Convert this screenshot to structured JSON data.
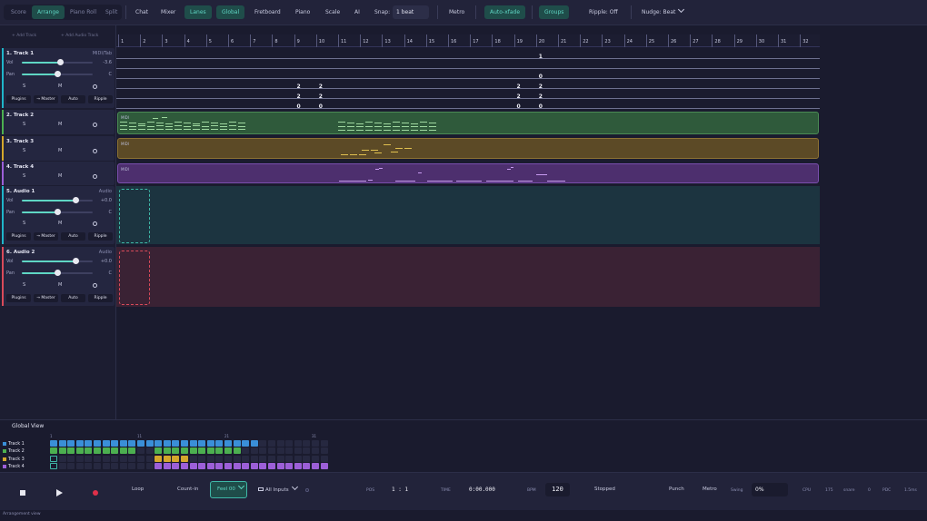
{
  "toolbar": {
    "view_tabs": [
      "Score",
      "Arrange",
      "Piano Roll",
      "Split"
    ],
    "active_view": "Arrange",
    "chat": "Chat",
    "mixer": "Mixer",
    "lanes": "Lanes",
    "global": "Global",
    "fretboard": "Fretboard",
    "piano": "Piano",
    "scale": "Scale",
    "ai": "AI",
    "snap_label": "Snap:",
    "snap_value": "1 beat",
    "metro": "Metro",
    "auto_xfade": "Auto-xfade",
    "groups": "Groups",
    "ripple": "Ripple: Off",
    "nudge": "Nudge: Beat"
  },
  "panel": {
    "add_track": "+ Add Track",
    "add_audio_track": "+ Add Audio Track",
    "labels": {
      "vol": "Vol",
      "pan": "Pan",
      "solo": "S",
      "mute": "M",
      "plugins": "Plugins",
      "master": "→ Master",
      "auto": "Auto",
      "ripple": "Ripple"
    },
    "tracks": [
      {
        "name": "1. Track 1",
        "kind": "MIDI/Tab",
        "vol": "-3.6",
        "pan": "C",
        "vol_level": 0.54,
        "pan_level": 0.5,
        "color": "#1fb5c9"
      },
      {
        "name": "2. Track 2",
        "color": "#4caf50"
      },
      {
        "name": "3. Track 3",
        "color": "#d4a72c"
      },
      {
        "name": "4. Track 4",
        "color": "#9c5fd8"
      },
      {
        "name": "5. Audio 1",
        "kind": "Audio",
        "vol": "+0.0",
        "pan": "C",
        "vol_level": 0.76,
        "pan_level": 0.5,
        "color": "#1fb5c9"
      },
      {
        "name": "6. Audio 2",
        "kind": "Audio",
        "vol": "+0.0",
        "pan": "C",
        "vol_level": 0.76,
        "pan_level": 0.5,
        "color": "#d94a5a"
      }
    ]
  },
  "ruler": {
    "bars": [
      "1",
      "2",
      "3",
      "4",
      "5",
      "6",
      "7",
      "8",
      "9",
      "10",
      "11",
      "12",
      "13",
      "14",
      "15",
      "16",
      "17",
      "18",
      "19",
      "20",
      "21",
      "22",
      "23",
      "24",
      "25",
      "26",
      "27",
      "28",
      "29",
      "30",
      "31",
      "32"
    ]
  },
  "tab": {
    "frets": [
      {
        "bar": 9,
        "line": 3,
        "v": "2"
      },
      {
        "bar": 9,
        "line": 4,
        "v": "2"
      },
      {
        "bar": 9,
        "line": 5,
        "v": "0"
      },
      {
        "bar": 10,
        "line": 3,
        "v": "2"
      },
      {
        "bar": 10,
        "line": 4,
        "v": "2"
      },
      {
        "bar": 10,
        "line": 5,
        "v": "0"
      },
      {
        "bar": 19,
        "line": 3,
        "v": "2"
      },
      {
        "bar": 19,
        "line": 4,
        "v": "2"
      },
      {
        "bar": 19,
        "line": 5,
        "v": "0"
      },
      {
        "bar": 20,
        "line": 0,
        "v": "1"
      },
      {
        "bar": 20,
        "line": 2,
        "v": "0"
      },
      {
        "bar": 20,
        "line": 3,
        "v": "2"
      },
      {
        "bar": 20,
        "line": 4,
        "v": "2"
      },
      {
        "bar": 20,
        "line": 5,
        "v": "0"
      }
    ]
  },
  "clips": {
    "midi_label": "MIDI"
  },
  "global_view": {
    "title": "Global View",
    "markers": [
      "1",
      "11",
      "21",
      "31"
    ],
    "tracks": [
      {
        "name": "Track 1",
        "color": "#3a8fd8"
      },
      {
        "name": "Track 2",
        "color": "#4caf50"
      },
      {
        "name": "Track 3",
        "color": "#d4a72c"
      },
      {
        "name": "Track 4",
        "color": "#9c5fd8"
      }
    ]
  },
  "transport": {
    "loop": "Loop",
    "count_in": "Count-in",
    "feel": "Feel 00",
    "inputs": "All Inputs",
    "pos_label": "POS",
    "pos": "1 : 1",
    "time_label": "TIME",
    "time": "0:00.000",
    "bpm_label": "BPM",
    "bpm": "120",
    "state": "Stopped",
    "punch": "Punch",
    "metro": "Metro",
    "swing_label": "Swing",
    "swing": "0%",
    "cpu_label": "CPU",
    "cpu": "175",
    "snare_label": "snare",
    "snare": "0",
    "pdc_label": "PDC",
    "pdc": "1.5ms"
  },
  "status_bar": "Arrangement view"
}
